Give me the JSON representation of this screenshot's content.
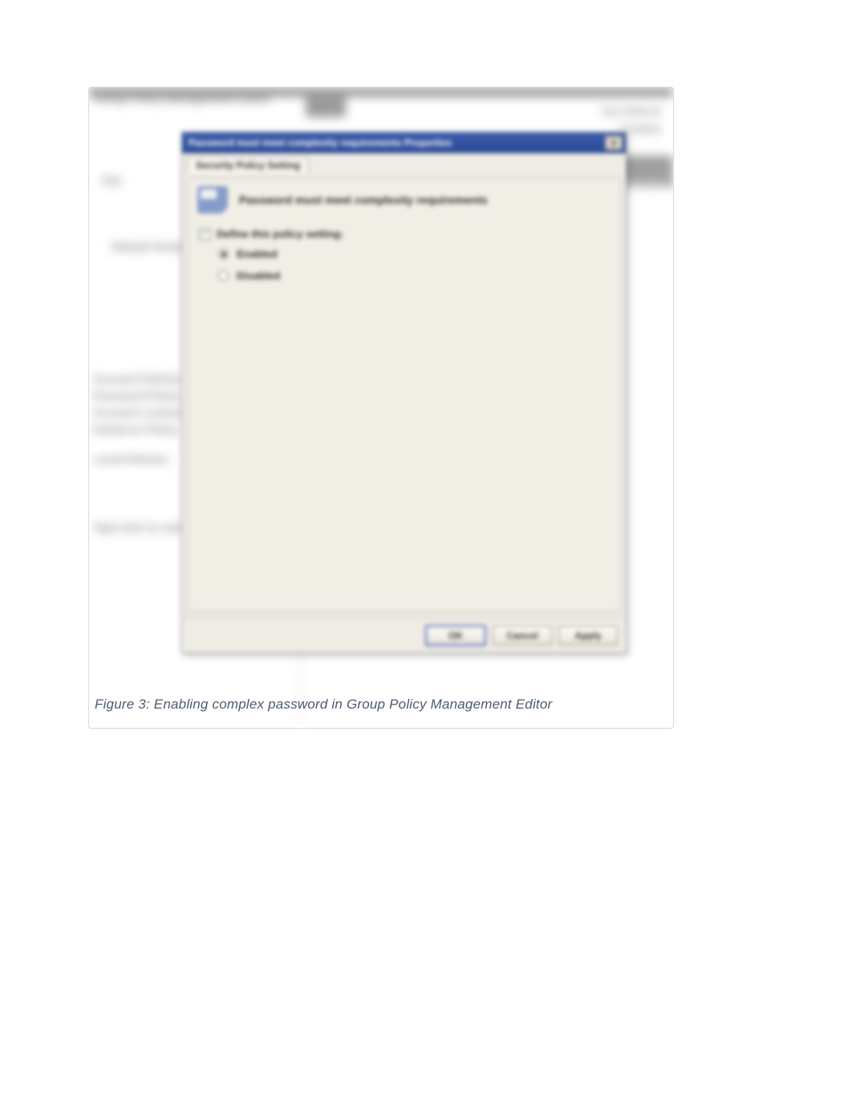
{
  "background": {
    "window_title": "Group Policy Management Editor",
    "menu_item": "File",
    "header_right_1": "Not Defined",
    "header_right_2": "Enabled",
    "sidebar_items": [
      "Default Domain Policy",
      "Account Policies",
      "Password Policy",
      "Account Lockout Policy",
      "Kerberos Policy",
      "Local Policies"
    ],
    "right_label": "Properties",
    "search_placeholder": "Type here to search"
  },
  "dialog": {
    "title": "Password must meet complexity requirements Properties",
    "close_label": "✕",
    "tab": "Security Policy Setting",
    "policy_name": "Password must meet complexity requirements",
    "define_label": "Define this policy setting:",
    "define_checked": true,
    "options": [
      {
        "label": "Enabled",
        "checked": true
      },
      {
        "label": "Disabled",
        "checked": false
      }
    ],
    "buttons": {
      "ok": "OK",
      "cancel": "Cancel",
      "apply": "Apply"
    }
  },
  "caption": "Figure 3: Enabling complex password in Group Policy Management Editor"
}
